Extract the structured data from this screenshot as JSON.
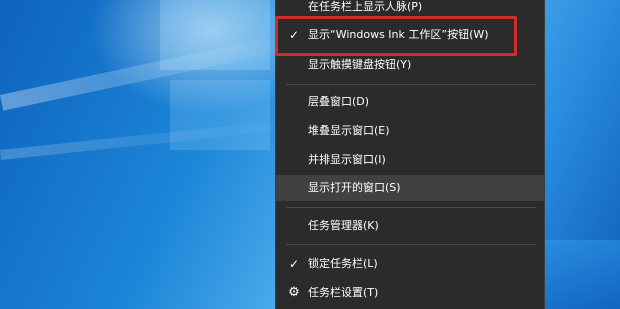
{
  "context_menu": {
    "items": [
      {
        "label": "在任务栏上显示人脉(P)",
        "checked": false
      },
      {
        "label": "显示“Windows Ink 工作区”按钮(W)",
        "checked": true,
        "highlighted": true
      },
      {
        "label": "显示触摸键盘按钮(Y)",
        "checked": false
      },
      {
        "label": "层叠窗口(D)",
        "checked": false
      },
      {
        "label": "堆叠显示窗口(E)",
        "checked": false
      },
      {
        "label": "并排显示窗口(I)",
        "checked": false
      },
      {
        "label": "显示打开的窗口(S)",
        "checked": false,
        "hovered": true
      },
      {
        "label": "任务管理器(K)",
        "checked": false
      },
      {
        "label": "锁定任务栏(L)",
        "checked": true
      },
      {
        "label": "任务栏设置(T)",
        "icon": "gear-icon"
      }
    ],
    "check_glyph": "✓",
    "gear_glyph": "⚙"
  },
  "colors": {
    "menu_background": "#2b2b2b",
    "highlight_border": "#d32a2a",
    "hover_background": "#414141"
  }
}
